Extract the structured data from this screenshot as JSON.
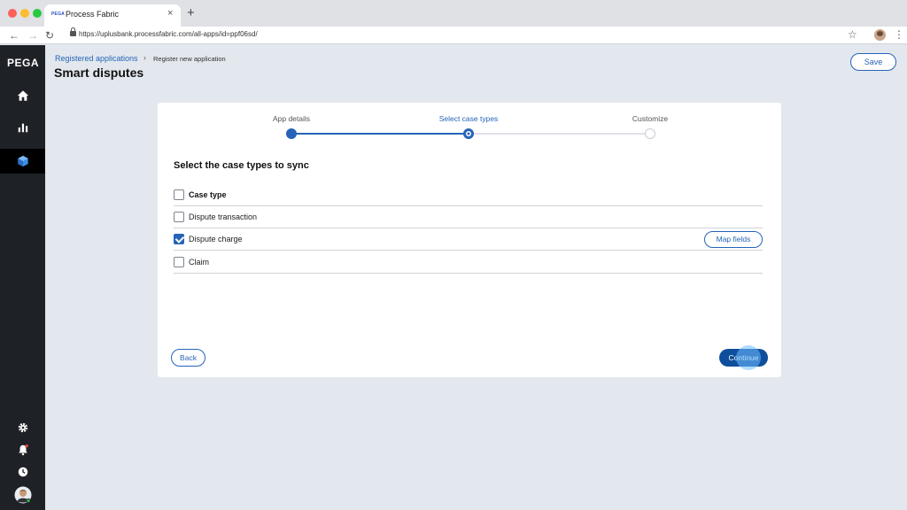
{
  "browser": {
    "tab_favicon": "PEGA",
    "tab_title": "Process Fabric",
    "tab_close": "×",
    "new_tab": "+",
    "url": "https://uplusbank.processfabric.com/all-apps/id=ppf06sd/",
    "icons": [
      "back-arrow-icon",
      "forward-arrow-icon",
      "reload-icon",
      "lock-icon",
      "star-icon",
      "kebab-menu-icon"
    ]
  },
  "sidebar": {
    "logo": "PEGA",
    "top_items": [
      "home-icon",
      "chart-icon",
      "cube-icon"
    ],
    "active_item": "cube-icon",
    "bottom_items": [
      "gear-icon",
      "bell-icon",
      "clock-icon",
      "avatar"
    ]
  },
  "header": {
    "breadcrumb_link": "Registered applications",
    "breadcrumb_separator": "›",
    "breadcrumb_current": "Register new application",
    "title": "Smart disputes",
    "save_label": "Save"
  },
  "wizard": {
    "steps": [
      {
        "label": "App details",
        "status": "done"
      },
      {
        "label": "Select case types",
        "status": "current"
      },
      {
        "label": "Customize",
        "status": "todo"
      }
    ],
    "accent_color": "#2664b8"
  },
  "case_types": {
    "title": "Select the case types to sync",
    "header_label": "Case type",
    "rows": [
      {
        "label": "Dispute transaction",
        "checked": false
      },
      {
        "label": "Dispute charge",
        "checked": true,
        "action": "Map fields"
      },
      {
        "label": "Claim",
        "checked": false
      }
    ]
  },
  "footer": {
    "back_label": "Back",
    "continue_label": "Continue"
  }
}
